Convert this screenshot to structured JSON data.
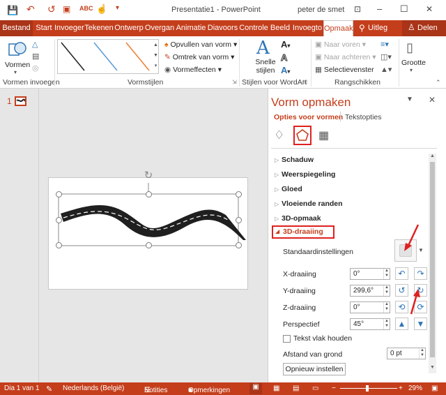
{
  "titlebar": {
    "title": "Presentatie1 - PowerPoint",
    "user": "peter de smet",
    "min": "–",
    "max": "☐",
    "close": "✕",
    "qat_icons": [
      "save-icon",
      "undo-icon",
      "redo-icon",
      "presenter-icon",
      "spelling-icon",
      "touch-icon",
      "customize-icon"
    ],
    "ribbon_display_icon": "⊡"
  },
  "tabs": {
    "file": "Bestand",
    "items": [
      "Start",
      "Invoegen",
      "Tekenen",
      "Ontwerp",
      "Overgang",
      "Animatie",
      "Diavoorstelling",
      "Controle",
      "Beeld",
      "Invoegen"
    ],
    "items_display": [
      "Start",
      "Invoeger",
      "Tekenen",
      "Ontwerp",
      "Overgan",
      "Animatie",
      "Diavoors",
      "Controle",
      "Beeld",
      "Invoegto"
    ],
    "active": "Opmaak",
    "tell": "Uitleg",
    "share": "Delen"
  },
  "ribbon": {
    "shapes_label": "Vormen",
    "insert_shapes_group": "Vormen invoegen",
    "styles_group": "Vormstijlen",
    "fill": "Opvullen van vorm",
    "outline": "Omtrek van vorm",
    "effects": "Vormeffecten",
    "quick_styles": "Snelle stijlen",
    "wordart_group": "Stijlen voor WordArt",
    "bring_forward": "Naar voren",
    "send_backward": "Naar achteren",
    "selection_pane": "Selectievenster",
    "arrange_group": "Rangschikken",
    "size": "Grootte",
    "style_colors": [
      "#1f1f1f",
      "#5b9bd5",
      "#ed7d31"
    ]
  },
  "thumbnail": {
    "number": "1"
  },
  "panel": {
    "title": "Vorm opmaken",
    "tab_shape": "Opties voor vormen",
    "tab_text": "Tekstopties",
    "sections": [
      "Schaduw",
      "Weerspiegeling",
      "Gloed",
      "Vloeiende randen",
      "3D-opmaak"
    ],
    "open_section": "3D-draaiing",
    "presets_label": "Standaardinstellingen",
    "x_label": "X-draaiing",
    "x_value": "0°",
    "y_label": "Y-draaiing",
    "y_value": "299,6°",
    "z_label": "Z-draaiing",
    "z_value": "0°",
    "persp_label": "Perspectief",
    "persp_value": "45°",
    "keep_text_flat": "Tekst vlak houden",
    "distance_label": "Afstand van grond",
    "distance_value": "0 pt",
    "reset": "Opnieuw instellen"
  },
  "status": {
    "slide": "Dia 1 van 1",
    "language": "Nederlands (België)",
    "notes": "Notities",
    "comments": "Opmerkingen",
    "zoom": "29%"
  }
}
